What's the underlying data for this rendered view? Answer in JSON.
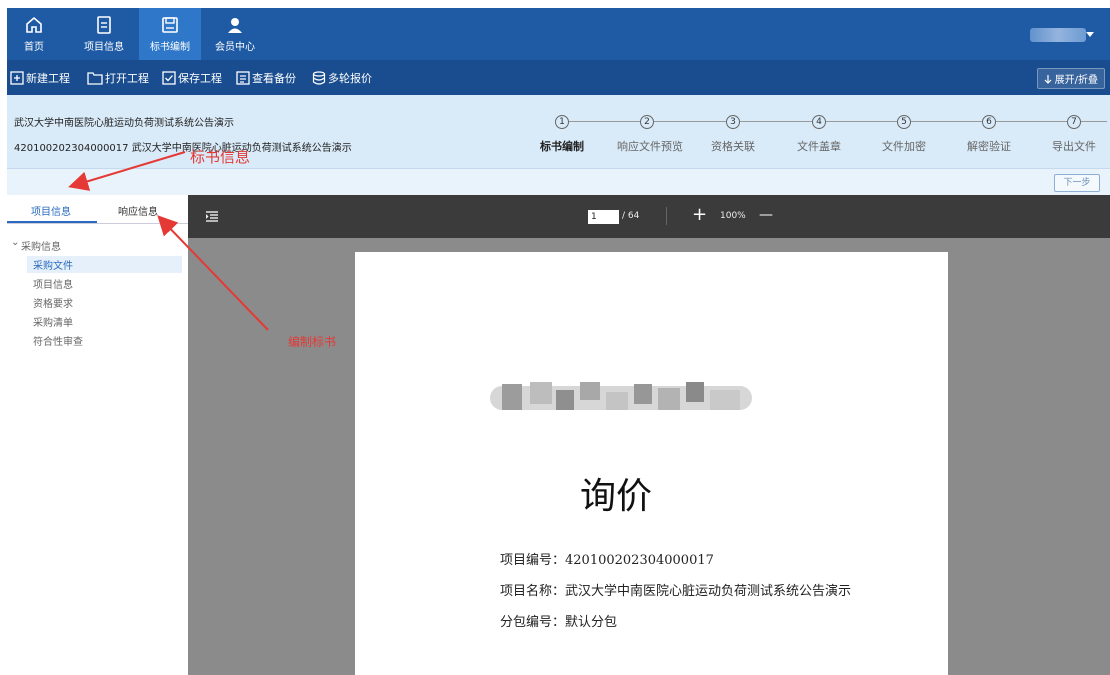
{
  "nav": {
    "items": [
      {
        "label": "首页",
        "icon": "home-icon"
      },
      {
        "label": "项目信息",
        "icon": "document-icon"
      },
      {
        "label": "标书编制",
        "icon": "save-icon"
      },
      {
        "label": "会员中心",
        "icon": "user-icon"
      }
    ],
    "active_index": 2
  },
  "toolbar": {
    "new_label": "新建工程",
    "open_label": "打开工程",
    "save_label": "保存工程",
    "backup_label": "查看备份",
    "multi_quote_label": "多轮报价",
    "expand_label": "展开/折叠"
  },
  "project": {
    "title_line": "武汉大学中南医院心脏运动负荷测试系统公告演示",
    "code_line": "420100202304000017 武汉大学中南医院心脏运动负荷测试系统公告演示"
  },
  "steps": [
    {
      "num": "1",
      "label": "标书编制"
    },
    {
      "num": "2",
      "label": "响应文件预览"
    },
    {
      "num": "3",
      "label": "资格关联"
    },
    {
      "num": "4",
      "label": "文件盖章"
    },
    {
      "num": "5",
      "label": "文件加密"
    },
    {
      "num": "6",
      "label": "解密验证"
    },
    {
      "num": "7",
      "label": "导出文件"
    }
  ],
  "next_label": "下一步",
  "left_tabs": [
    "项目信息",
    "响应信息"
  ],
  "tree": {
    "root": "采购信息",
    "children": [
      "采购文件",
      "项目信息",
      "资格要求",
      "采购清单",
      "符合性审查"
    ],
    "selected_index": 0
  },
  "viewer": {
    "page_current": "1",
    "page_total": "/ 64",
    "zoom": "100%",
    "plus": "+",
    "minus": "—"
  },
  "document": {
    "heading": "询价",
    "project_number": "项目编号：420100202304000017",
    "project_name": "项目名称：武汉大学中南医院心脏运动负荷测试系统公告演示",
    "package_number": "分包编号：默认分包"
  },
  "annotations": {
    "bid_info": "标书信息",
    "edit_bid": "编制标书"
  },
  "colors": {
    "nav_bg": "#1f5ba5",
    "toolbar_bg": "#1a4d8f",
    "info_bg": "#d9eaf8",
    "accent": "#2a6bbd",
    "annotation": "#e53935"
  }
}
